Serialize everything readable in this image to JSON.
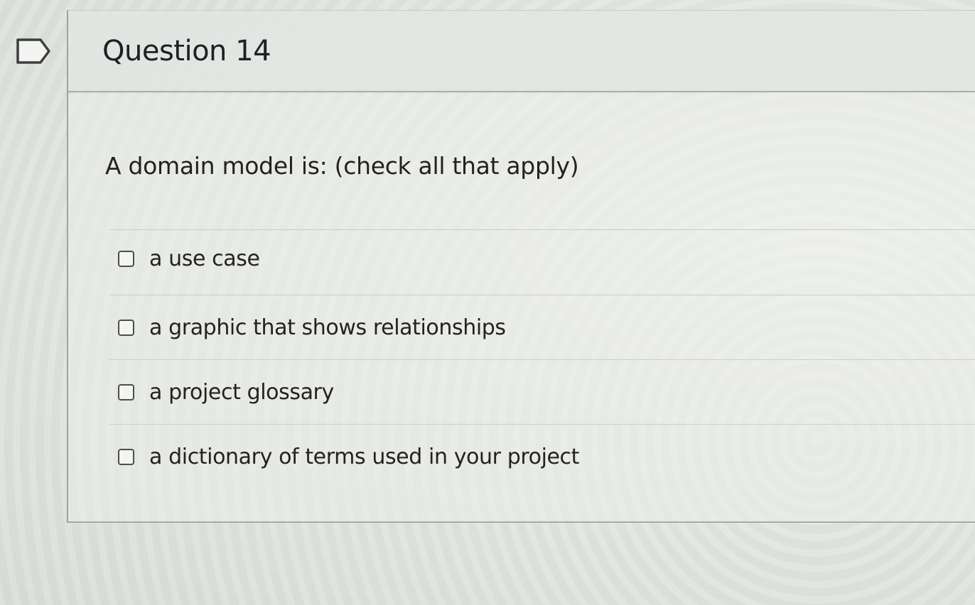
{
  "question": {
    "title": "Question 14",
    "prompt": "A domain model is: (check all that apply)",
    "answers": [
      {
        "label": "a use case",
        "checked": false
      },
      {
        "label": "a graphic that shows relationships",
        "checked": false
      },
      {
        "label": "a project glossary",
        "checked": false
      },
      {
        "label": "a dictionary of terms used in your project",
        "checked": false
      }
    ]
  },
  "icons": {
    "flag": "flag-icon"
  }
}
